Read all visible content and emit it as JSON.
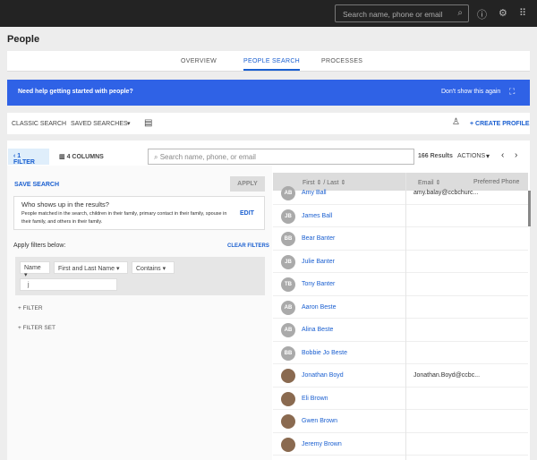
{
  "topbar": {
    "search_placeholder": "Search name, phone or email"
  },
  "page_title": "People",
  "tabs": [
    {
      "label": "OVERVIEW"
    },
    {
      "label": "PEOPLE SEARCH",
      "active": true
    },
    {
      "label": "PROCESSES"
    }
  ],
  "banner": {
    "text": "Need help getting started with people?",
    "dismiss": "Don't show this again"
  },
  "toolbar": {
    "classic": "CLASSIC SEARCH",
    "saved": "SAVED SEARCHES",
    "create": "+ CREATE PROFILE"
  },
  "controls": {
    "filter": "1 FILTER",
    "columns": "4 COLUMNS",
    "search_placeholder": "Search name, phone, or email",
    "results": "166 Results",
    "actions": "ACTIONS"
  },
  "left": {
    "save_search": "SAVE SEARCH",
    "apply": "APPLY",
    "who_title": "Who shows up in the results?",
    "who_text": "People matched in the search, children in their family, primary contact in their family, spouse in their family, and others in their family.",
    "edit": "EDIT",
    "apply_filters": "Apply filters below:",
    "clear": "CLEAR FILTERS",
    "filter_field": "Name",
    "filter_sub": "First and Last Name",
    "filter_op": "Contains",
    "filter_value": "j",
    "add_filter": "+ FILTER",
    "add_filter_set": "+ FILTER SET"
  },
  "table": {
    "col_name": "First",
    "col_last": "Last",
    "col_email": "Email",
    "col_phone": "Preferred Phone",
    "rows": [
      {
        "initials": "AB",
        "name": "Amy Ball",
        "email": "amy.balay@ccbchurc..."
      },
      {
        "initials": "JB",
        "name": "James Ball",
        "email": ""
      },
      {
        "initials": "BB",
        "name": "Bear Banter",
        "email": ""
      },
      {
        "initials": "JB",
        "name": "Julie Banter",
        "email": ""
      },
      {
        "initials": "TB",
        "name": "Tony Banter",
        "email": ""
      },
      {
        "initials": "AB",
        "name": "Aaron Beste",
        "email": ""
      },
      {
        "initials": "AB",
        "name": "Alina Beste",
        "email": ""
      },
      {
        "initials": "BB",
        "name": "Bobbie Jo Beste",
        "email": ""
      },
      {
        "initials": "",
        "name": "Jonathan Boyd",
        "email": "Jonathan.Boyd@ccbc..."
      },
      {
        "initials": "",
        "name": "Eli Brown",
        "email": ""
      },
      {
        "initials": "",
        "name": "Gwen Brown",
        "email": ""
      },
      {
        "initials": "",
        "name": "Jeremy Brown",
        "email": ""
      }
    ]
  }
}
